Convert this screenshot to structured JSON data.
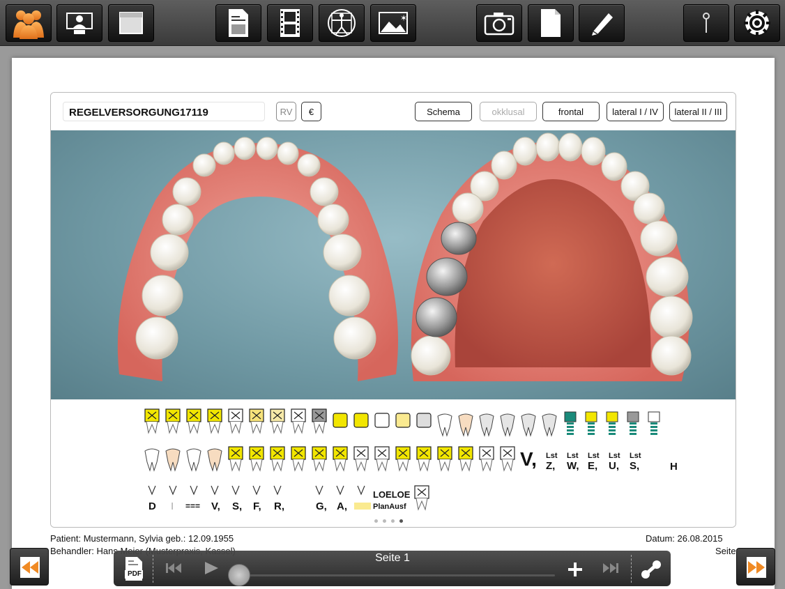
{
  "toolbar": {
    "buttons": [
      "patients-icon",
      "presentation-icon",
      "folder-icon",
      "document-icon",
      "film-icon",
      "vitruvian-icon",
      "image-icon",
      "camera-icon",
      "blank-page-icon",
      "pencil-icon",
      "pin-icon",
      "settings-icon"
    ]
  },
  "panel": {
    "title": "REGELVERSORGUNG17119",
    "rv_label": "RV",
    "euro_label": "€",
    "view_buttons": {
      "schema": "Schema",
      "okklusal": "okklusal",
      "frontal": "frontal",
      "lateral_1_4": "lateral I / IV",
      "lateral_2_3": "lateral II / III"
    }
  },
  "symbols": {
    "row3_letters": [
      "D",
      "I",
      "===",
      "V,",
      "S,",
      "F,",
      "R,",
      "G,",
      "A,"
    ],
    "row2_letters": [
      "V,",
      "Z,",
      "W,",
      "E,",
      "U,",
      "S,",
      "H"
    ],
    "lst_label": "Lst",
    "loeloe": "LOELOE",
    "planausf": "PlanAusf",
    "page_dots": 4,
    "active_dot": 3
  },
  "footer": {
    "patient": "Patient: Mustermann, Sylvia geb.: 12.09.1955",
    "behandler": "Behandler: Hans Meier (Musterpraxis, Kassel)",
    "datum": "Datum: 26.08.2015",
    "seite": "Seite 1"
  },
  "player": {
    "page_label": "Seite 1",
    "pdf_label": "PDF",
    "progress": 0
  },
  "colors": {
    "accent_orange": "#f08a24",
    "crown_yellow": "#f2e600",
    "background_teal": "#7aa4ae",
    "gum_pink": "#e07a70"
  }
}
